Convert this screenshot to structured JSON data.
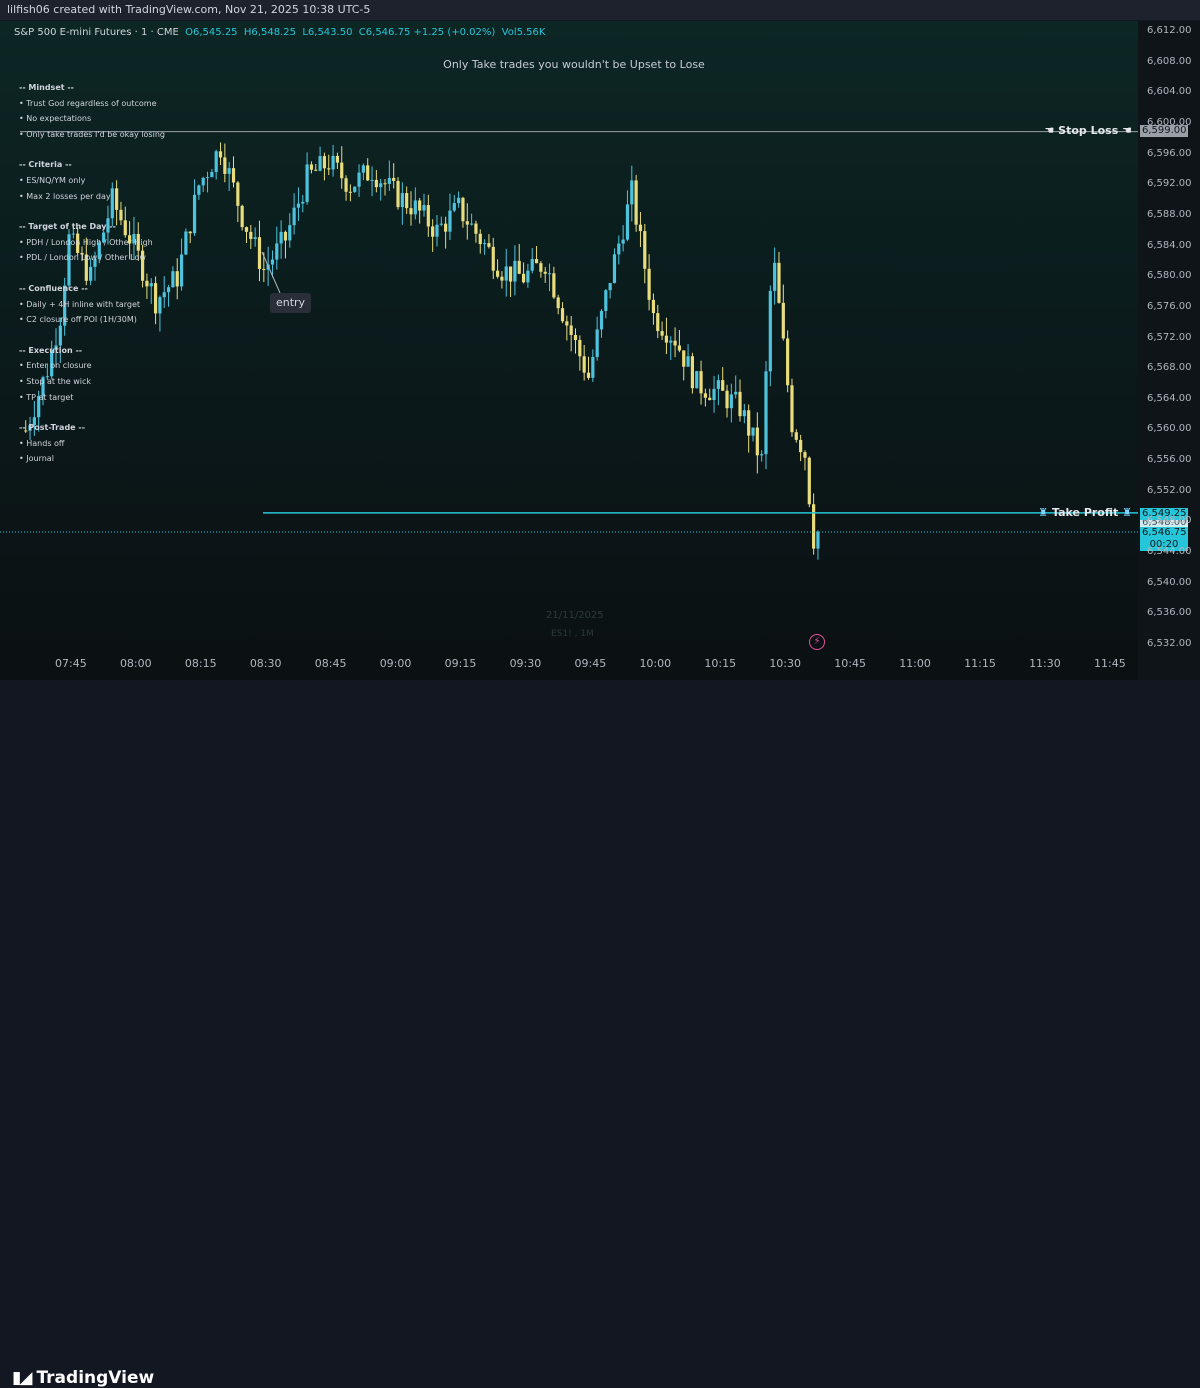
{
  "header": {
    "title": "lilfish06 created with TradingView.com, Nov 21, 2025 10:38 UTC-5"
  },
  "symbol": {
    "name": "S&P 500 E-mini Futures · 1 · CME",
    "open": "O6,545.25",
    "high": "H6,548.25",
    "low": "L6,543.50",
    "close": "C6,546.75",
    "change": "+1.25 (+0.02%)",
    "volume": "Vol5.56K"
  },
  "banner": "Only Take trades you wouldn't be Upset to Lose",
  "notes": [
    {
      "text": "-- Mindset --",
      "head": true
    },
    {
      "text": "• Trust God regardless of outcome",
      "head": false
    },
    {
      "text": "• No expectations",
      "head": false
    },
    {
      "text": "• Only take trades I'd be okay losing",
      "head": false
    },
    {
      "text": "-- Criteria --",
      "head": true
    },
    {
      "text": "• ES/NQ/YM only",
      "head": false
    },
    {
      "text": "• Max 2 losses per day",
      "head": false
    },
    {
      "text": "-- Target of the Day --",
      "head": true
    },
    {
      "text": "• PDH / London High / Other High",
      "head": false
    },
    {
      "text": "• PDL / London Low / Other Low",
      "head": false
    },
    {
      "text": "-- Confluence --",
      "head": true
    },
    {
      "text": "• Daily + 4H inline with target",
      "head": false
    },
    {
      "text": "• C2 closure off POI (1H/30M)",
      "head": false
    },
    {
      "text": "-- Execution --",
      "head": true
    },
    {
      "text": "• Enter on closure",
      "head": false
    },
    {
      "text": "• Stop at the wick",
      "head": false
    },
    {
      "text": "• TP at target",
      "head": false
    },
    {
      "text": "-- Post-Trade --",
      "head": true
    },
    {
      "text": "• Hands off",
      "head": false
    },
    {
      "text": "• Journal",
      "head": false
    }
  ],
  "price_axis": [
    "6,612.00",
    "6,608.00",
    "6,604.00",
    "6,600.00",
    "6,596.00",
    "6,592.00",
    "6,588.00",
    "6,584.00",
    "6,580.00",
    "6,576.00",
    "6,572.00",
    "6,568.00",
    "6,564.00",
    "6,560.00",
    "6,556.00",
    "6,552.00",
    "6,548.00",
    "6,544.00",
    "6,540.00",
    "6,536.00",
    "6,532.00"
  ],
  "time_axis": [
    "07:45",
    "08:00",
    "08:15",
    "08:30",
    "08:45",
    "09:00",
    "09:15",
    "09:30",
    "09:45",
    "10:00",
    "10:15",
    "10:30",
    "10:45",
    "11:00",
    "11:15",
    "11:30",
    "11:45"
  ],
  "stop_loss": {
    "label": "Stop Loss",
    "icon": "pointing-hand-icon",
    "price": "6,599.00"
  },
  "take_profit": {
    "label": "Take Profit",
    "icon": "money-bag-icon",
    "price": "6,549.25"
  },
  "last_price": {
    "price": "6,546.75",
    "countdown": "00:20",
    "underlay": "6,548.00"
  },
  "entry_label": "entry",
  "watermark": {
    "date": "21/11/2025",
    "symbol": "ES1! , 1M"
  },
  "brand": "TradingView",
  "colors": {
    "bull": "#4dc3de",
    "bear": "#e9dc7c",
    "tp_line": "#26c6da",
    "sl_line": "#9aa0a6",
    "accent_pink": "#e14fa1"
  },
  "chart_data": {
    "type": "candlestick",
    "symbol": "S&P 500 E-mini Futures",
    "interval": "1",
    "x_range": [
      "07:35",
      "11:50"
    ],
    "ylim": [
      6532,
      6613
    ],
    "levels": {
      "stop_loss": 6599.0,
      "take_profit": 6549.25,
      "last": 6546.75
    },
    "anchors": [
      [
        "07:35",
        6560
      ],
      [
        "07:40",
        6568
      ],
      [
        "07:43",
        6575
      ],
      [
        "07:45",
        6585
      ],
      [
        "07:50",
        6580
      ],
      [
        "07:55",
        6590
      ],
      [
        "08:00",
        6584
      ],
      [
        "08:05",
        6577
      ],
      [
        "08:10",
        6580
      ],
      [
        "08:15",
        6592
      ],
      [
        "08:20",
        6597
      ],
      [
        "08:25",
        6588
      ],
      [
        "08:30",
        6581
      ],
      [
        "08:35",
        6585
      ],
      [
        "08:40",
        6593
      ],
      [
        "08:45",
        6595
      ],
      [
        "08:50",
        6592
      ],
      [
        "08:55",
        6594
      ],
      [
        "09:00",
        6591
      ],
      [
        "09:05",
        6589
      ],
      [
        "09:10",
        6586
      ],
      [
        "09:15",
        6589
      ],
      [
        "09:20",
        6585
      ],
      [
        "09:25",
        6581
      ],
      [
        "09:30",
        6580
      ],
      [
        "09:35",
        6582
      ],
      [
        "09:40",
        6574
      ],
      [
        "09:45",
        6567
      ],
      [
        "09:50",
        6580
      ],
      [
        "09:55",
        6591
      ],
      [
        "10:00",
        6575
      ],
      [
        "10:05",
        6572
      ],
      [
        "10:10",
        6566
      ],
      [
        "10:15",
        6565
      ],
      [
        "10:20",
        6563
      ],
      [
        "10:25",
        6556
      ],
      [
        "10:27",
        6578
      ],
      [
        "10:28",
        6581
      ],
      [
        "10:30",
        6571
      ],
      [
        "10:32",
        6561
      ],
      [
        "10:35",
        6557
      ],
      [
        "10:37",
        6546
      ],
      [
        "10:38",
        6546.75
      ]
    ]
  }
}
